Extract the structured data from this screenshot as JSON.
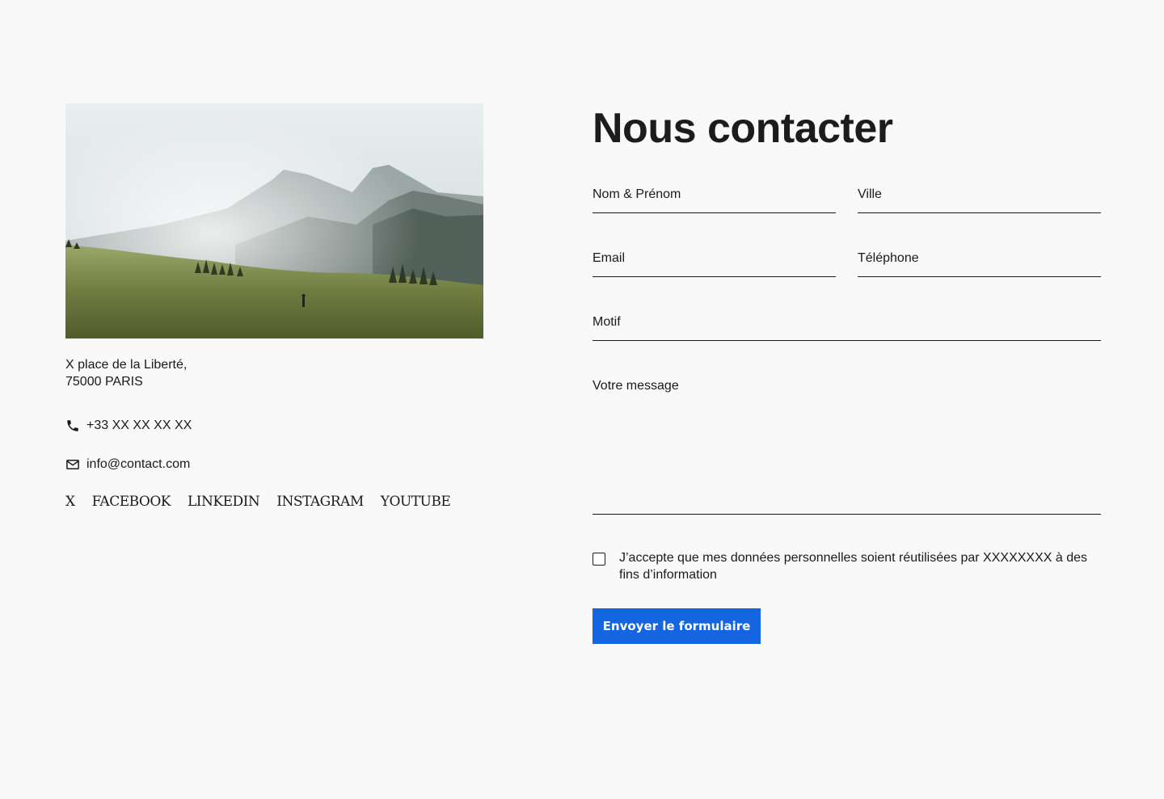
{
  "contact_info": {
    "address_line1": "X place de la Liberté,",
    "address_line2": "75000 PARIS",
    "phone": "+33 XX XX XX XX",
    "email": "info@contact.com"
  },
  "social_links": [
    "X",
    "FACEBOOK",
    "LINKEDIN",
    "INSTAGRAM",
    "YOUTUBE"
  ],
  "form": {
    "title": "Nous contacter",
    "name_placeholder": "Nom & Prénom",
    "city_placeholder": "Ville",
    "email_placeholder": "Email",
    "phone_placeholder": "Téléphone",
    "reason_placeholder": "Motif",
    "message_placeholder": "Votre message",
    "consent_text": "J’accepte que mes données personnelles soient réutilisées par XXXXXXXX à des fins d’information",
    "submit_label": "Envoyer le formulaire"
  },
  "colors": {
    "background": "#f9f9fa",
    "accent": "#1565e0",
    "text": "#1a1a1a"
  },
  "icons": [
    "phone-icon",
    "mail-icon"
  ]
}
